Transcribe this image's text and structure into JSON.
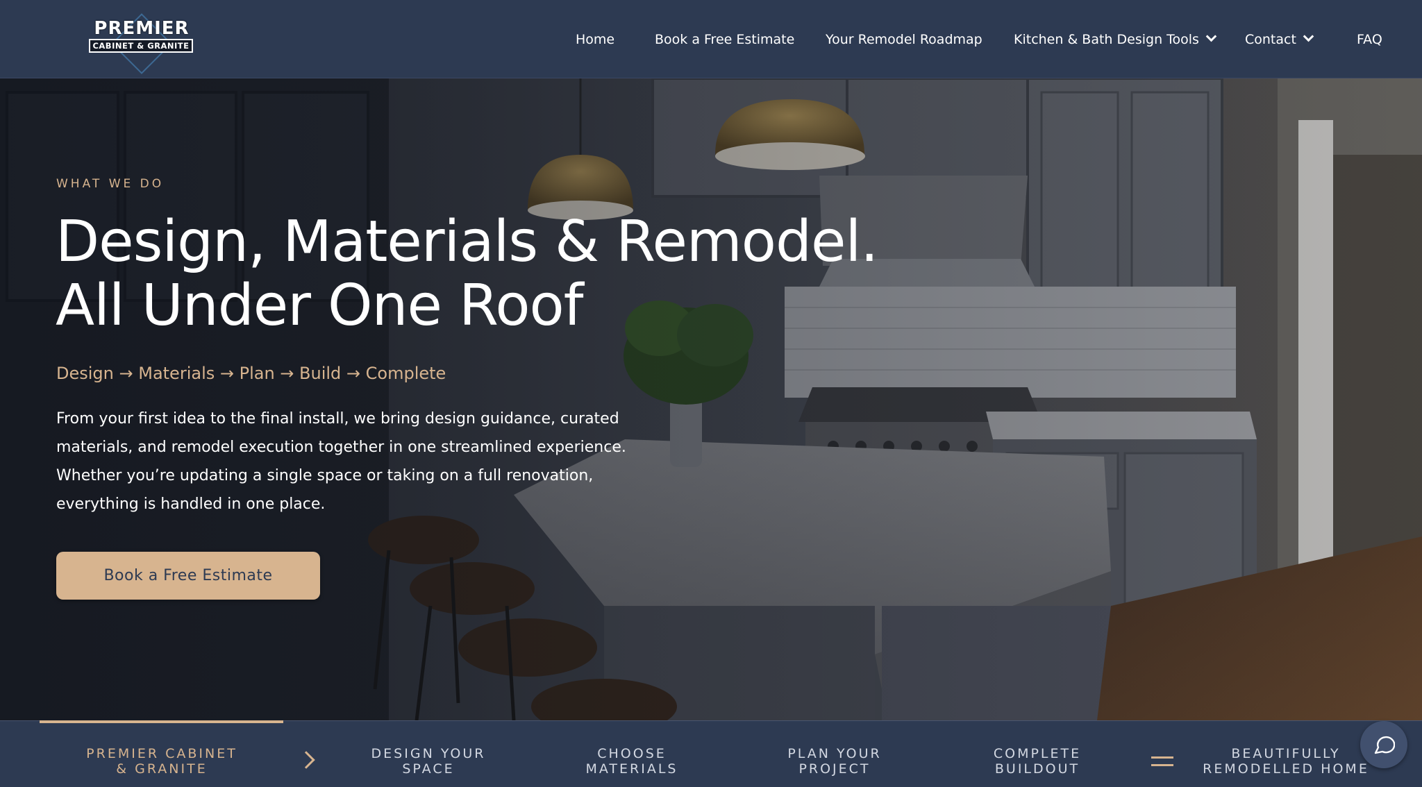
{
  "header": {
    "logo": {
      "top": "PREMIER",
      "bottom": "CABINET & GRANITE"
    },
    "nav": [
      {
        "label": "Home",
        "dropdown": false
      },
      {
        "label": "Book a Free Estimate",
        "dropdown": false
      },
      {
        "label": "Your Remodel Roadmap",
        "dropdown": false
      },
      {
        "label": "Kitchen & Bath Design Tools",
        "dropdown": true
      },
      {
        "label": "Contact",
        "dropdown": true
      },
      {
        "label": "FAQ",
        "dropdown": false
      }
    ]
  },
  "hero": {
    "eyebrow": "WHAT WE DO",
    "headline_line1": "Design, Materials & Remodel.",
    "headline_line2": "All Under One Roof",
    "steps_line": "Design → Materials → Plan → Build → Complete",
    "body": "From your first idea to the final install, we bring design guidance, curated materials, and remodel execution together in one streamlined experience. Whether you’re updating a single space or taking on a full renovation, everything is handled in one place.",
    "cta_label": "Book a Free Estimate",
    "background_icon": "kitchen-photo"
  },
  "process": {
    "steps": [
      {
        "line1": "PREMIER CABINET",
        "line2": "& GRANITE",
        "active": true
      },
      {
        "line1": "DESIGN YOUR",
        "line2": "SPACE",
        "active": false
      },
      {
        "line1": "CHOOSE",
        "line2": "MATERIALS",
        "active": false
      },
      {
        "line1": "PLAN YOUR",
        "line2": "PROJECT",
        "active": false
      },
      {
        "line1": "COMPLETE",
        "line2": "BUILDOUT",
        "active": false
      },
      {
        "line1": "BEAUTIFULLY",
        "line2": "REMODELLED HOME",
        "active": false
      }
    ]
  },
  "chat": {
    "icon": "chat-bubble-icon"
  },
  "colors": {
    "navy": "#2d3a52",
    "accent_gold": "#d7b48f",
    "white": "#ffffff"
  }
}
